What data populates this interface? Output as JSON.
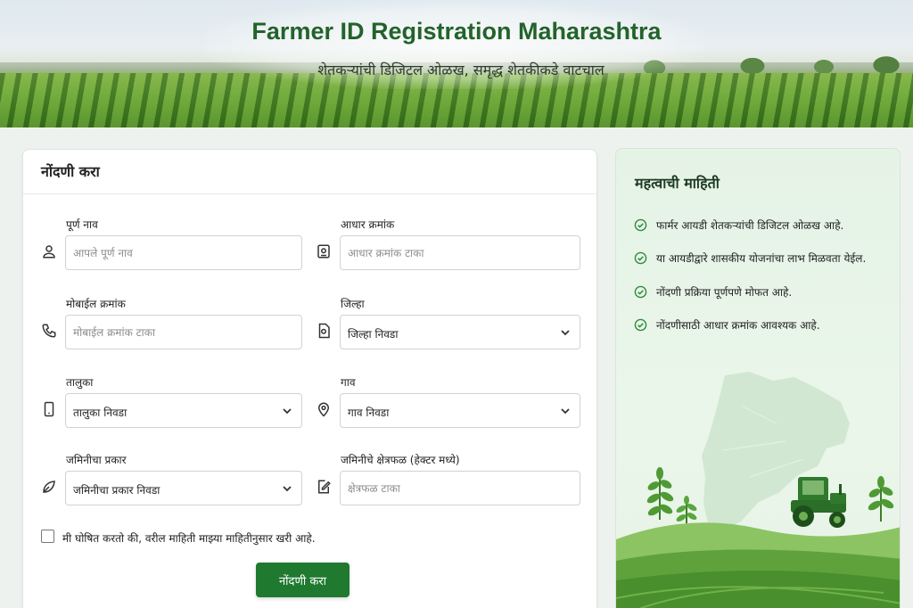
{
  "hero": {
    "title": "Farmer ID Registration Maharashtra",
    "subtitle": "शेतकऱ्यांची डिजिटल ओळख, समृद्ध शेतकीकडे वाटचाल"
  },
  "form": {
    "heading": "नोंदणी करा",
    "fields": {
      "full_name": {
        "label": "पूर्ण नाव",
        "placeholder": "आपले पूर्ण नाव",
        "icon": "user-icon"
      },
      "aadhaar": {
        "label": "आधार क्रमांक",
        "placeholder": "आधार क्रमांक टाका",
        "icon": "id-card-icon"
      },
      "mobile": {
        "label": "मोबाईल क्रमांक",
        "placeholder": "मोबाईल क्रमांक टाका",
        "icon": "phone-icon"
      },
      "district": {
        "label": "जिल्हा",
        "value": "जिल्हा निवडा",
        "icon": "document-icon"
      },
      "taluka": {
        "label": "तालुका",
        "value": "तालुका निवडा",
        "icon": "mobile-device-icon"
      },
      "village": {
        "label": "गाव",
        "value": "गाव निवडा",
        "icon": "location-pin-icon"
      },
      "land_type": {
        "label": "जमिनीचा प्रकार",
        "value": "जमिनीचा प्रकार निवडा",
        "icon": "leaf-badge-icon"
      },
      "land_area": {
        "label": "जमिनीचे क्षेत्रफळ (हेक्टर मध्ये)",
        "placeholder": "क्षेत्रफळ टाका",
        "icon": "area-edit-icon"
      }
    },
    "declaration": "मी घोषित करतो की, वरील माहिती माझ्या माहितीनुसार खरी आहे.",
    "submit_label": "नोंदणी करा"
  },
  "info": {
    "title": "महत्वाची माहिती",
    "items": [
      "फार्मर आयडी शेतकऱ्यांची डिजिटल ओळख आहे.",
      "या आयडीद्वारे शासकीय योजनांचा लाभ मिळवता येईल.",
      "नोंदणी प्रक्रिया पूर्णपणे मोफत आहे.",
      "नोंदणीसाठी आधार क्रमांक आवश्यक आहे."
    ]
  },
  "colors": {
    "brand_green": "#1f7a30",
    "title_green": "#23632a",
    "check_green": "#2e8b3c"
  }
}
